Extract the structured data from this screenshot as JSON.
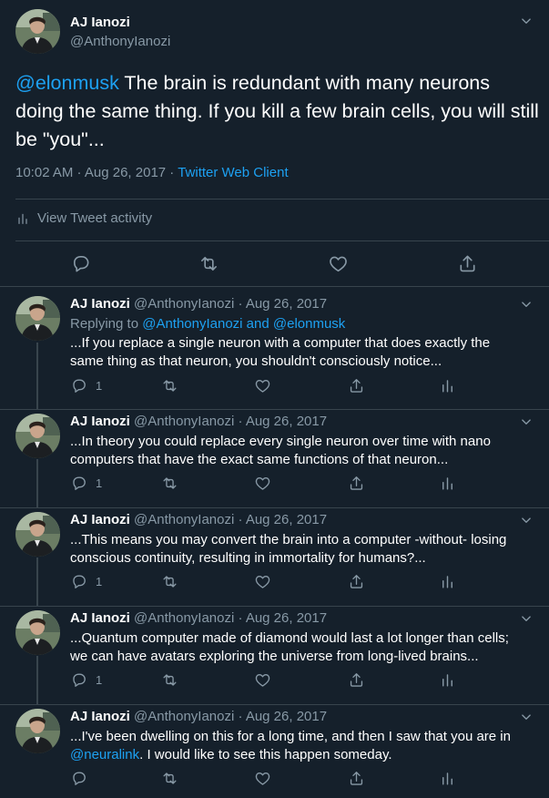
{
  "colors": {
    "background": "#15202b",
    "link": "#1da1f2",
    "muted": "#8899a6",
    "border": "#38444d"
  },
  "main_tweet": {
    "name": "AJ Ianozi",
    "handle": "@AnthonyIanozi",
    "mention": "@elonmusk",
    "text": " The brain is redundant with many neurons doing the same thing.  If you kill a few brain cells, you will still be \"you\"...",
    "time": "10:02 AM · Aug 26, 2017 · ",
    "client": "Twitter Web Client",
    "activity_label": "View Tweet activity",
    "icons": [
      "reply-icon",
      "retweet-icon",
      "like-icon",
      "share-icon"
    ]
  },
  "replies": [
    {
      "name": "AJ Ianozi",
      "meta": "@AnthonyIanozi · Aug 26, 2017",
      "replying_prefix": "Replying to ",
      "replying_to": "@AnthonyIanozi and @elonmusk",
      "line1": "...If you replace a single neuron with a computer that does exactly the",
      "line2": "same thing as that neuron, you shouldn't consciously notice...",
      "reply_count": "1"
    },
    {
      "name": "AJ Ianozi",
      "meta": "@AnthonyIanozi · Aug 26, 2017",
      "line1": "...In theory you could replace every single neuron over time with nano",
      "line2": "computers that have the exact same functions of that neuron...",
      "reply_count": "1"
    },
    {
      "name": "AJ Ianozi",
      "meta": "@AnthonyIanozi · Aug 26, 2017",
      "line1": "...This means you may convert the brain into a computer -without- losing",
      "line2": "conscious continuity, resulting in immortality for humans?...",
      "reply_count": "1"
    },
    {
      "name": "AJ Ianozi",
      "meta": "@AnthonyIanozi · Aug 26, 2017",
      "line1": "...Quantum computer made of diamond would last a lot longer than cells;",
      "line2": "we can have avatars exploring the universe from long-lived brains...",
      "reply_count": "1"
    },
    {
      "name": "AJ Ianozi",
      "meta": "@AnthonyIanozi · Aug 26, 2017",
      "line1": "...I've been dwelling on this for a long time, and then I saw that you are in",
      "mention": "@neuralink",
      "line2_rest": ". I would like to see this happen someday.",
      "reply_count": ""
    }
  ]
}
